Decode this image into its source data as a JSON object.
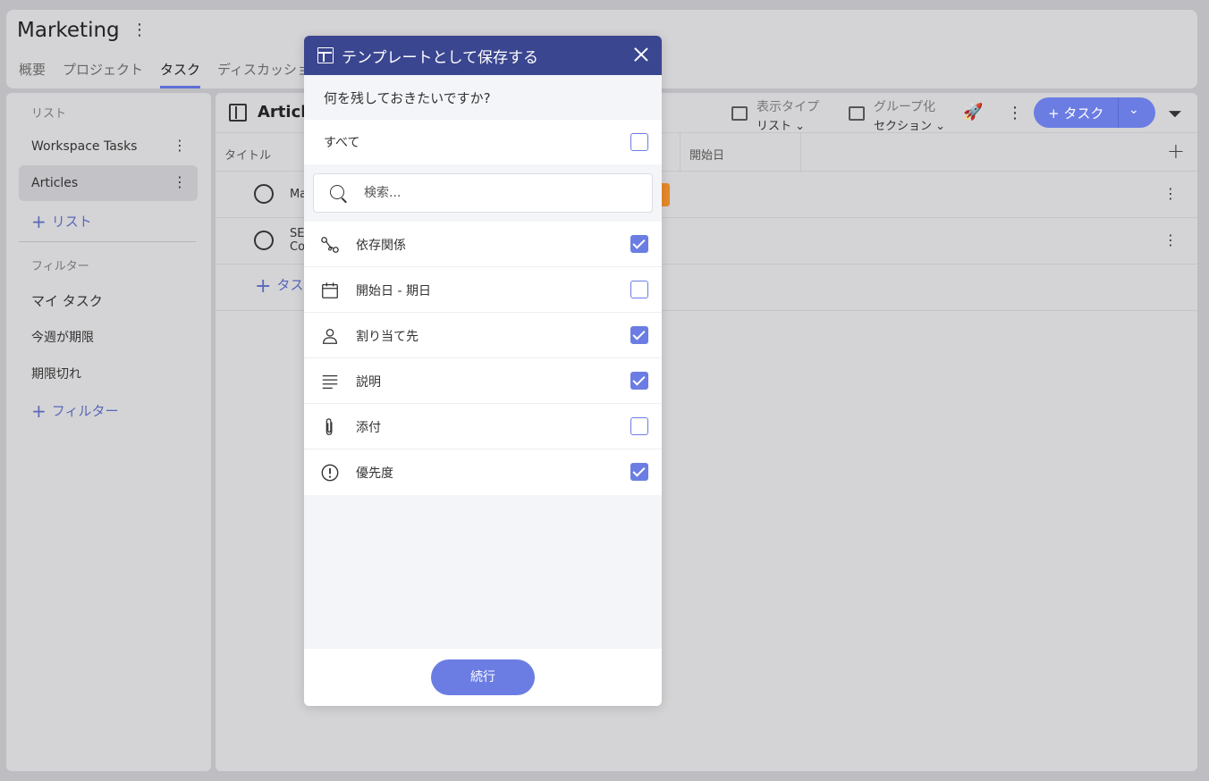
{
  "app": {
    "project_title": "Marketing",
    "tabs": [
      {
        "label": "概要"
      },
      {
        "label": "プロジェクト"
      },
      {
        "label": "タスク"
      },
      {
        "label": "ディスカッション"
      }
    ],
    "active_tab": "タスク"
  },
  "sidebar": {
    "lists_heading": "リスト",
    "lists": [
      {
        "label": "Workspace Tasks"
      },
      {
        "label": "Articles"
      }
    ],
    "add_list": "リスト",
    "filters_heading": "フィルター",
    "filters": [
      {
        "label": "マイ タスク"
      },
      {
        "label": "今週が期限"
      },
      {
        "label": "期限切れ"
      }
    ],
    "add_filter": "フィルター"
  },
  "main": {
    "title": "Article",
    "view_type": {
      "label": "表示タイプ",
      "value": "リスト"
    },
    "group_by": {
      "label": "グループ化",
      "value": "セクション"
    },
    "add_task": "タスク",
    "columns": {
      "title": "タイトル",
      "start_date": "開始日"
    },
    "rows": [
      {
        "line1": "Ma",
        "line2": ""
      },
      {
        "line1": "SE",
        "line2": "Co"
      }
    ],
    "add_task_row": "タス"
  },
  "modal": {
    "title": "テンプレートとして保存する",
    "question": "何を残しておきたいですか?",
    "all_label": "すべて",
    "all_checked": false,
    "search_placeholder": "検索...",
    "options": [
      {
        "label": "依存関係",
        "icon": "dependency-icon",
        "checked": true
      },
      {
        "label": "開始日 - 期日",
        "icon": "calendar-icon",
        "checked": false
      },
      {
        "label": "割り当て先",
        "icon": "person-icon",
        "checked": true
      },
      {
        "label": "説明",
        "icon": "description-lines-icon",
        "checked": true
      },
      {
        "label": "添付",
        "icon": "paperclip-icon",
        "checked": false
      },
      {
        "label": "優先度",
        "icon": "priority-exclamation-icon",
        "checked": true
      }
    ],
    "continue_label": "続行"
  },
  "colors": {
    "accent": "#6b7de3",
    "modal_header": "#3b4690",
    "priority_tag": "#e88a2a"
  }
}
